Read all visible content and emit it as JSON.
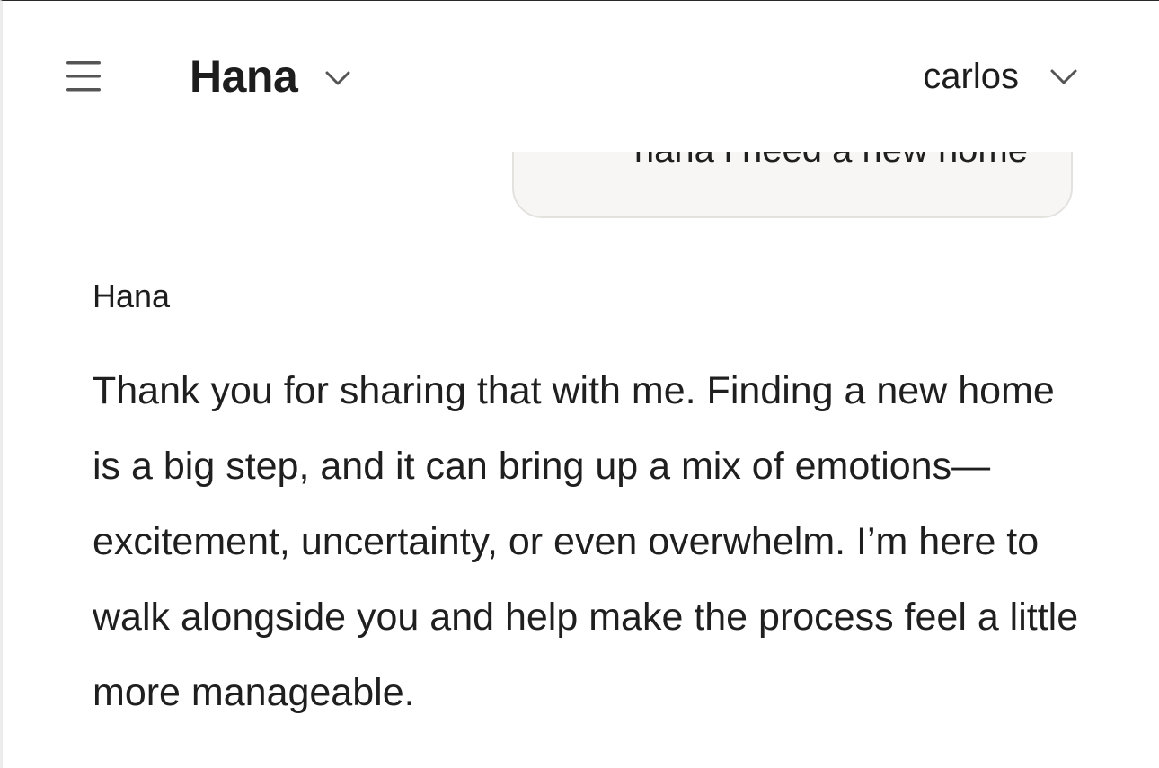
{
  "header": {
    "menu_icon": "hamburger-menu-icon",
    "agent_name": "Hana",
    "agent_chevron_icon": "chevron-down-icon",
    "user_name": "carlos",
    "user_chevron_icon": "chevron-down-icon"
  },
  "conversation": {
    "user_message": "hana i need a new home",
    "assistant_label": "Hana",
    "assistant_message": "Thank you for sharing that with me. Finding a new home is a big step, and it can bring up a mix of emotions—excitement, uncertainty, or even overwhelm. I’m here to walk alongside you and help make the process feel a little more manageable."
  },
  "colors": {
    "text": "#1f1f1f",
    "bubble_background": "#f7f6f4",
    "bubble_border": "#e3e2df",
    "icon": "#555555"
  }
}
